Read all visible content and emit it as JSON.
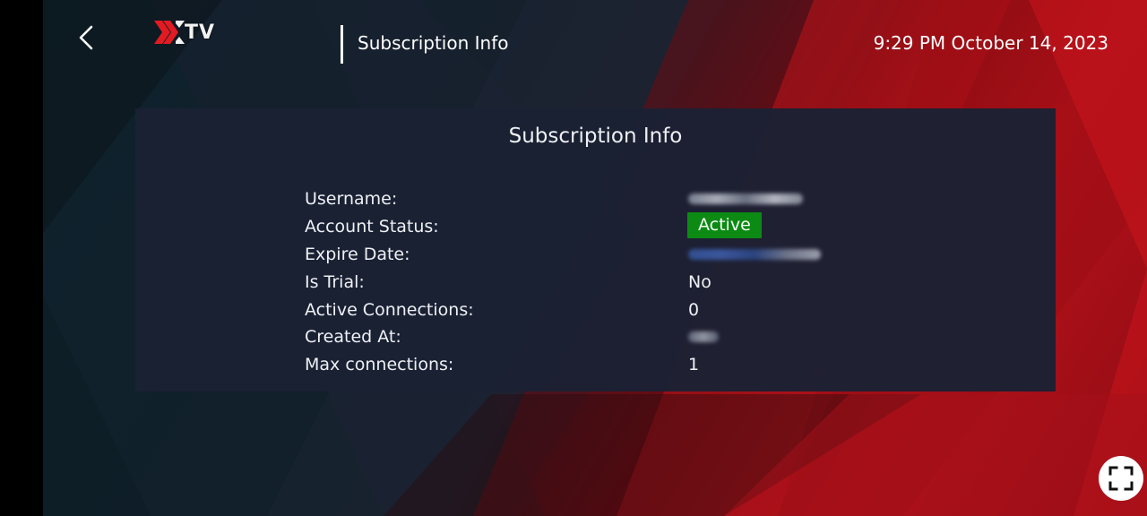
{
  "app": {
    "logo_text": "TV"
  },
  "header": {
    "title": "Subscription Info",
    "datetime": "9:29 PM October 14, 2023"
  },
  "panel": {
    "title": "Subscription Info",
    "rows": [
      {
        "label": "Username:",
        "value": "",
        "redacted": true
      },
      {
        "label": "Account Status:",
        "value": "Active",
        "badge": true
      },
      {
        "label": "Expire Date:",
        "value": "",
        "redacted": true
      },
      {
        "label": "Is Trial:",
        "value": "No"
      },
      {
        "label": "Active Connections:",
        "value": "0"
      },
      {
        "label": "Created At:",
        "value": "",
        "redacted": true
      },
      {
        "label": "Max connections:",
        "value": "1"
      }
    ]
  },
  "icons": {
    "back": "chevron-left-icon",
    "logo": "xtv-logo-icon",
    "fullscreen": "fullscreen-icon"
  },
  "colors": {
    "status_active": "#0c8a14",
    "panel_bg": "#1b2134",
    "accent_red": "#b5121b",
    "logo_red": "#e11b22"
  }
}
